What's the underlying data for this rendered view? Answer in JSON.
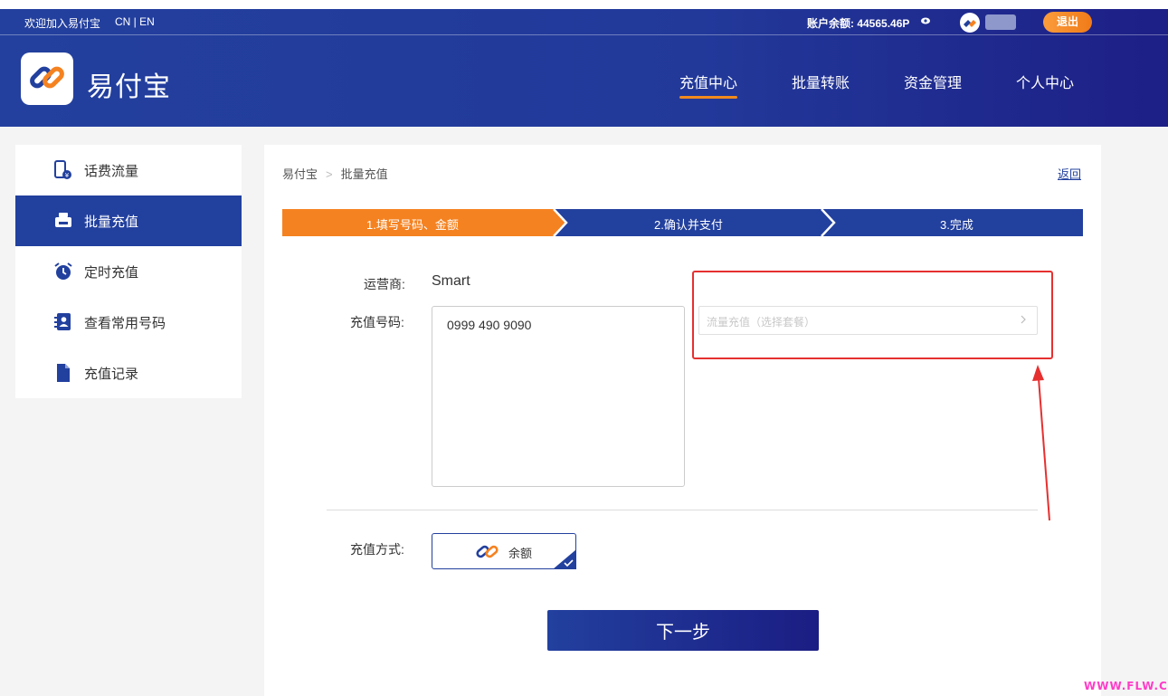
{
  "topbar": {
    "welcome": "欢迎加入易付宝",
    "lang": "CN | EN",
    "balance": "账户余额: 44565.46P",
    "logout": "退出"
  },
  "brand": {
    "name": "易付宝"
  },
  "nav": {
    "items": [
      "充值中心",
      "批量转账",
      "资金管理",
      "个人中心"
    ],
    "active": "充值中心"
  },
  "sidebar": {
    "items": [
      {
        "label": "话费流量",
        "icon": "phone-icon"
      },
      {
        "label": "批量充值",
        "icon": "printer-icon"
      },
      {
        "label": "定时充值",
        "icon": "alarm-clock-icon"
      },
      {
        "label": "查看常用号码",
        "icon": "contacts-icon"
      },
      {
        "label": "充值记录",
        "icon": "document-icon"
      }
    ],
    "active": "批量充值"
  },
  "breadcrumb": {
    "home": "易付宝",
    "sep": ">",
    "current": "批量充值"
  },
  "back_label": "返回",
  "steps": [
    "1.填写号码、金额",
    "2.确认并支付",
    "3.完成"
  ],
  "form": {
    "operator_label": "运营商:",
    "operator_value": "Smart",
    "phone_label": "充值号码:",
    "phone_value": "0999 490 9090",
    "package_placeholder": "流量充值（选择套餐）",
    "payment_label": "充值方式:",
    "payment_option": "余额"
  },
  "next_button": "下一步",
  "watermark": "WWW.FLW.COOL",
  "colors": {
    "primary": "#22409e",
    "accent_orange": "#f58220",
    "highlight_red": "#e63030"
  }
}
